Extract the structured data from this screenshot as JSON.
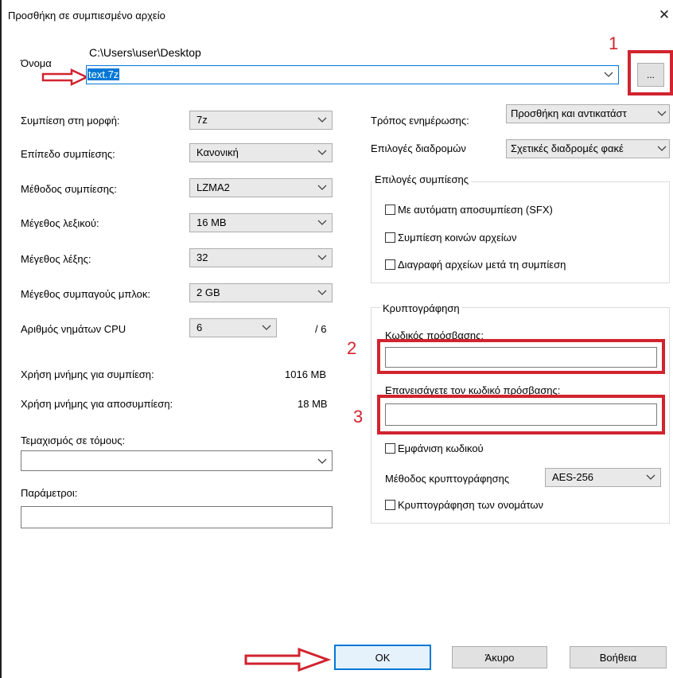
{
  "window": {
    "title": "Προσθήκη σε συμπιεσμένο αρχείο",
    "close_glyph": "✕"
  },
  "archive": {
    "name_label": "Όνομα",
    "path": "C:\\Users\\user\\Desktop",
    "filename": "text.7z",
    "browse_label": "..."
  },
  "left": {
    "format_label": "Συμπίεση στη μορφή:",
    "format_value": "7z",
    "level_label": "Επίπεδο συμπίεσης:",
    "level_value": "Κανονική",
    "method_label": "Μέθοδος συμπίεσης:",
    "method_value": "LZMA2",
    "dict_label": "Μέγεθος λεξικού:",
    "dict_value": "16 MB",
    "word_label": "Μέγεθος λέξης:",
    "word_value": "32",
    "solid_label": "Μέγεθος συμπαγούς μπλοκ:",
    "solid_value": "2 GB",
    "threads_label": "Αριθμός νημάτων CPU",
    "threads_value": "6",
    "threads_max": "/ 6",
    "mem_comp_label": "Χρήση μνήμης για συμπίεση:",
    "mem_comp_value": "1016 MB",
    "mem_decomp_label": "Χρήση μνήμης για αποσυμπίεση:",
    "mem_decomp_value": "18 MB",
    "split_label": "Τεμαχισμός σε τόμους:",
    "split_value": "",
    "params_label": "Παράμετροι:",
    "params_value": ""
  },
  "right": {
    "update_label": "Τρόπος ενημέρωσης:",
    "update_value": "Προσθήκη και αντικατάστ",
    "path_label": "Επιλογές διαδρομών",
    "path_value": "Σχετικές διαδρομές φακέ",
    "options_title": "Επιλογές συμπίεσης",
    "sfx_label": "Με αυτόματη αποσυμπίεση (SFX)",
    "shared_label": "Συμπίεση κοινών αρχείων",
    "delete_label": "Διαγραφή αρχείων μετά τη συμπίεση",
    "encryption_title": "Κρυπτογράφηση",
    "password_label": "Κωδικός πρόσβασης:",
    "reenter_label": "Επανεισάγετε τον κωδικό πρόσβασης:",
    "show_password_label": "Εμφάνιση κωδικού",
    "enc_method_label": "Μέθοδος κρυπτογράφησης",
    "enc_method_value": "AES-256",
    "encrypt_names_label": "Κρυπτογράφηση των ονομάτων"
  },
  "buttons": {
    "ok": "OK",
    "cancel": "Άκυρο",
    "help": "Βοήθεια"
  },
  "annotations": {
    "n1": "1",
    "n2": "2",
    "n3": "3",
    "color": "#d1242f"
  }
}
